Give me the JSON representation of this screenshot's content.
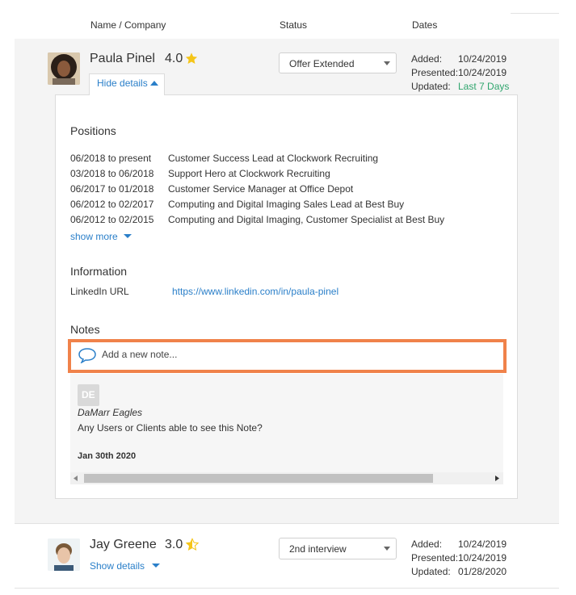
{
  "header": {
    "col_name": "Name / Company",
    "col_status": "Status",
    "col_dates": "Dates"
  },
  "candidates": [
    {
      "name": "Paula Pinel",
      "rating": "4.0",
      "toggle_label": "Hide details",
      "status": "Offer Extended",
      "dates": {
        "added_label": "Added:",
        "added": "10/24/2019",
        "presented_label": "Presented:",
        "presented": "10/24/2019",
        "updated_label": "Updated:",
        "updated": "Last 7 Days"
      },
      "details": {
        "positions_title": "Positions",
        "positions": [
          {
            "range": "06/2018 to present",
            "title": "Customer Success Lead at Clockwork Recruiting"
          },
          {
            "range": "03/2018 to 06/2018",
            "title": "Support Hero at Clockwork Recruiting"
          },
          {
            "range": "06/2017 to 01/2018",
            "title": "Customer Service Manager at Office Depot"
          },
          {
            "range": "06/2012 to 02/2017",
            "title": "Computing and Digital Imaging Sales Lead at Best Buy"
          },
          {
            "range": "06/2012 to 02/2015",
            "title": "Computing and Digital Imaging, Customer Specialist at Best Buy"
          }
        ],
        "show_more": "show more",
        "information_title": "Information",
        "linkedin_label": "LinkedIn URL",
        "linkedin_url": "https://www.linkedin.com/in/paula-pinel",
        "notes_title": "Notes",
        "note_placeholder": "Add a new note...",
        "notes": [
          {
            "initials": "DE",
            "author": "DaMarr Eagles",
            "text": "Any Users or Clients able to see this Note?",
            "date": "Jan 30th 2020"
          }
        ]
      }
    },
    {
      "name": "Jay Greene",
      "rating": "3.0",
      "toggle_label": "Show details",
      "status": "2nd interview",
      "dates": {
        "added_label": "Added:",
        "added": "10/24/2019",
        "presented_label": "Presented:",
        "presented": "10/24/2019",
        "updated_label": "Updated:",
        "updated": "01/28/2020"
      }
    }
  ],
  "colors": {
    "accent": "#2a7fc9",
    "highlight": "#f0824a",
    "star": "#f5c518",
    "green": "#2fa56d"
  },
  "icons": [
    "star-icon",
    "star-half-icon",
    "caret-up-icon",
    "caret-down-icon",
    "chat-bubble-icon",
    "dropdown-caret-icon",
    "scroll-left-icon",
    "scroll-right-icon"
  ]
}
